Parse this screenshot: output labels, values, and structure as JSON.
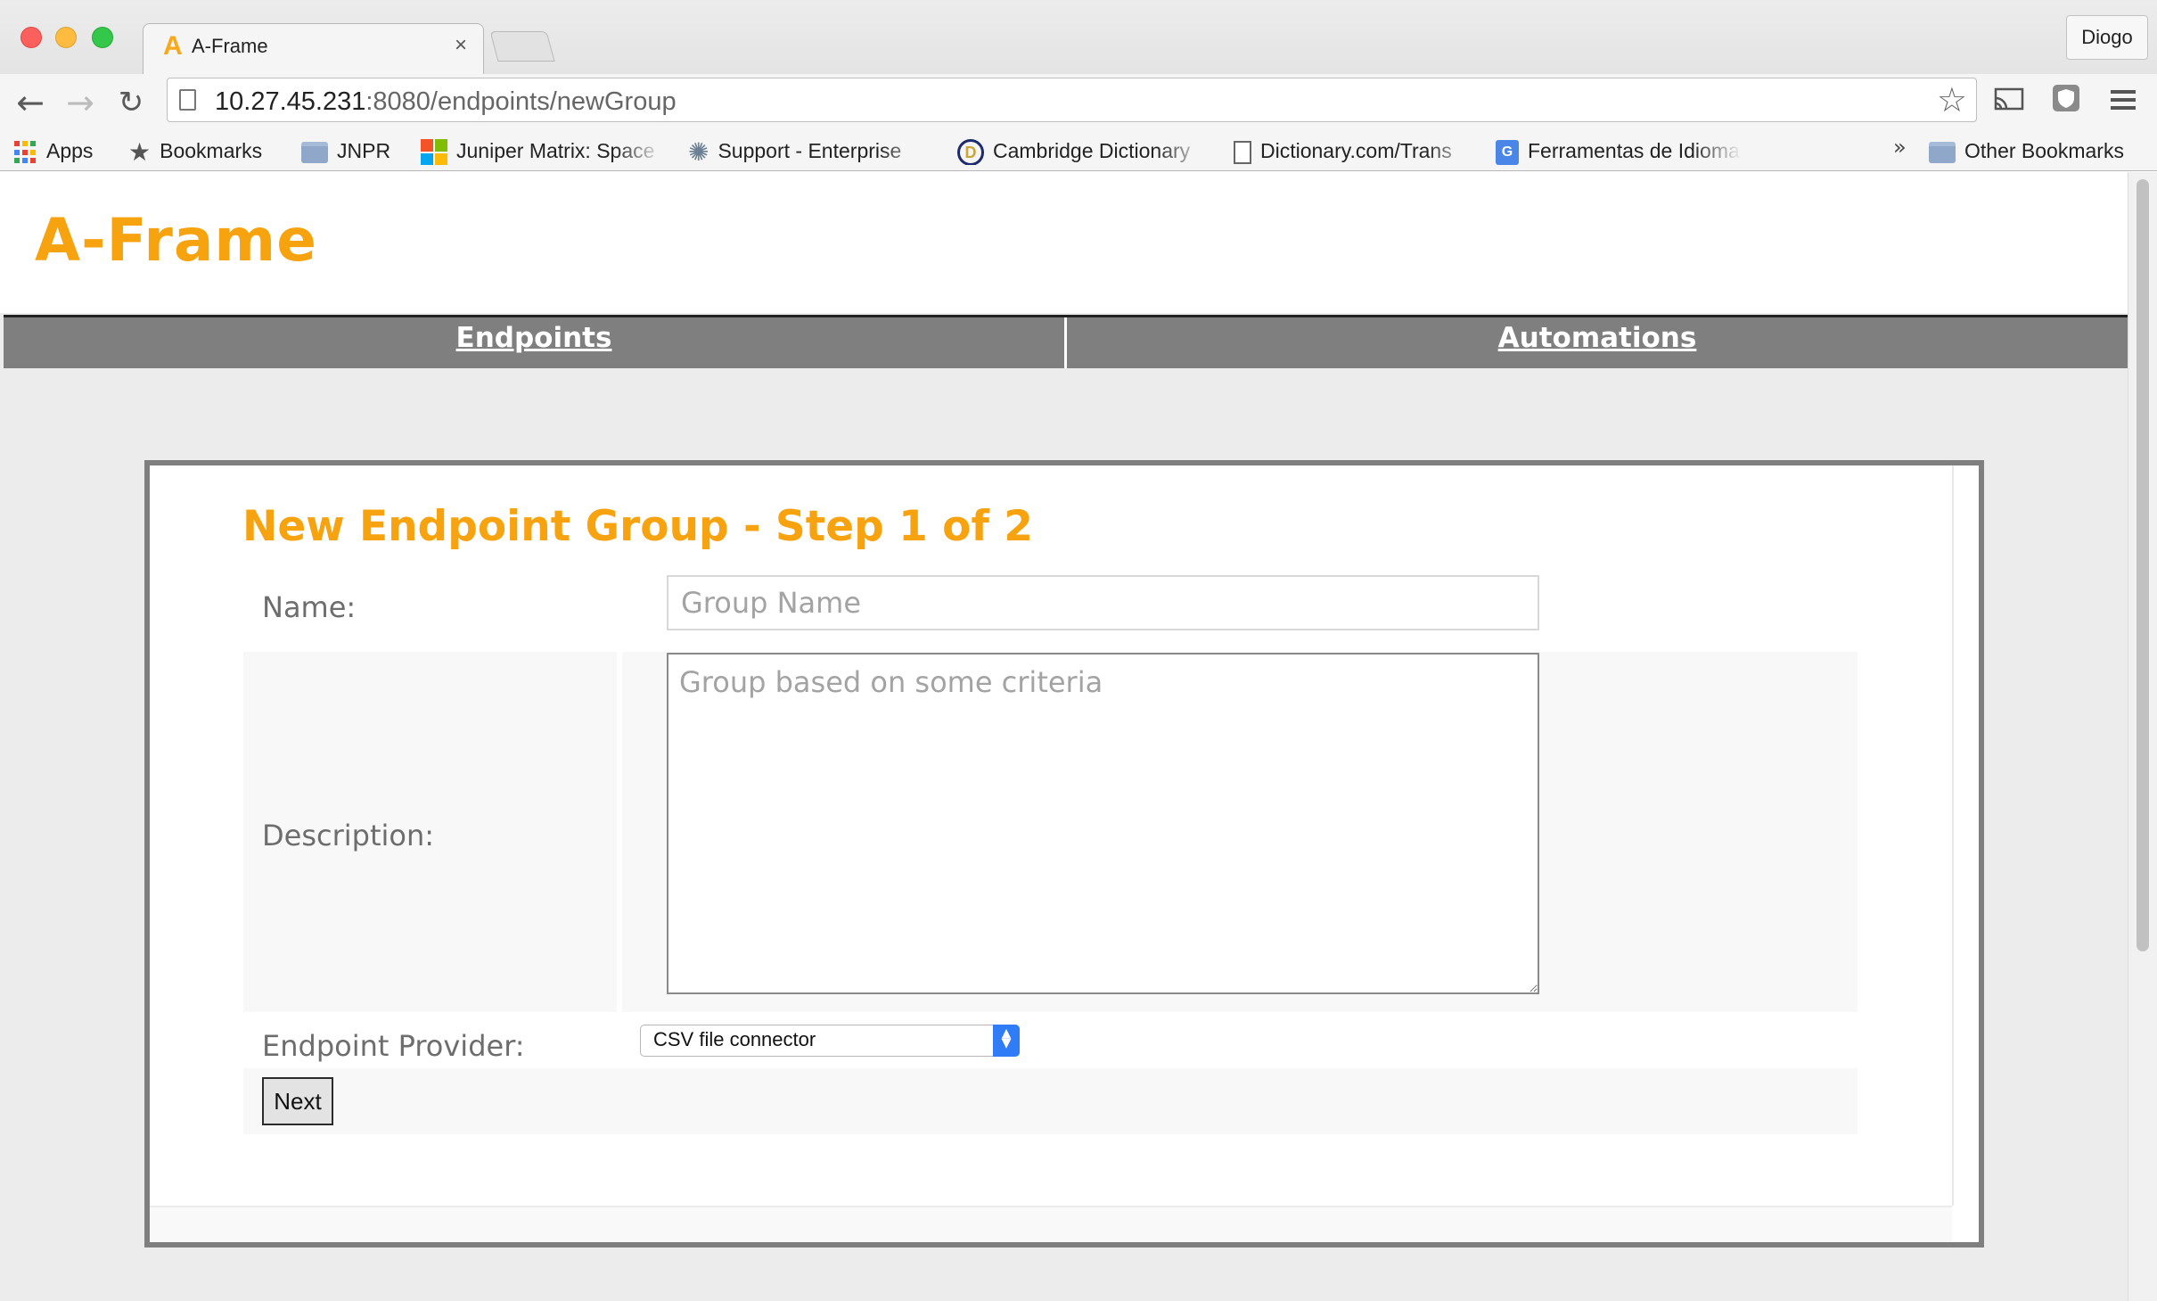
{
  "browser": {
    "tab_title": "A-Frame",
    "tab_close": "×",
    "profile_name": "Diogo",
    "url_host": "10.27.45.231",
    "url_rest": ":8080/endpoints/newGroup",
    "bookmarks": {
      "apps": "Apps",
      "bookmarks": "Bookmarks",
      "jnpr": "JNPR",
      "juniper": "Juniper Matrix: Space",
      "support": "Support - Enterprise",
      "cambridge": "Cambridge Dictionary",
      "dictionary": "Dictionary.com/Trans",
      "ferramentas": "Ferramentas de Idioma",
      "overflow": "»",
      "other": "Other Bookmarks"
    }
  },
  "site": {
    "logo": "A-Frame",
    "nav": {
      "endpoints": "Endpoints",
      "automations": "Automations"
    }
  },
  "form": {
    "title": "New Endpoint Group - Step 1 of 2",
    "name_label": "Name:",
    "name_placeholder": "Group Name",
    "description_label": "Description:",
    "description_placeholder": "Group based on some criteria",
    "provider_label": "Endpoint Provider:",
    "provider_selected": "CSV file connector",
    "next_label": "Next"
  },
  "colors": {
    "brand_orange": "#f7a20f",
    "nav_gray": "#7f7f7f",
    "select_accent": "#2f7cf6"
  }
}
